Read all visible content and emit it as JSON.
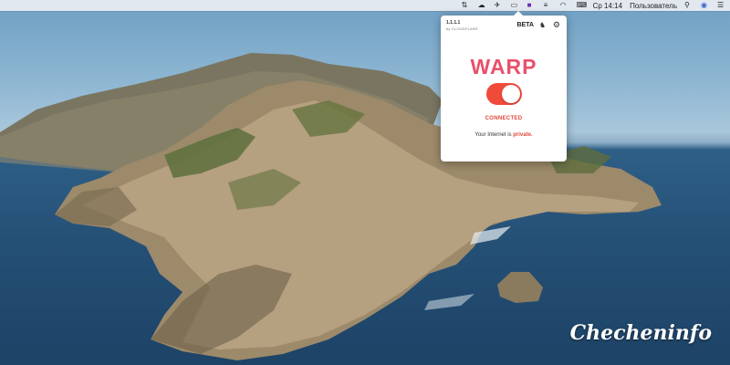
{
  "menubar": {
    "items": [
      {
        "icon": "network-icon",
        "glyph": "⇅"
      },
      {
        "icon": "cloudflare-warp-icon",
        "glyph": "☁"
      },
      {
        "icon": "telegram-icon",
        "glyph": "✈"
      },
      {
        "icon": "display-icon",
        "glyph": "▭"
      },
      {
        "icon": "app-icon",
        "glyph": "■"
      },
      {
        "icon": "menu-icon",
        "glyph": "≡"
      },
      {
        "icon": "wifi-icon",
        "glyph": "◠"
      },
      {
        "icon": "keyboard-icon",
        "glyph": "⌨"
      }
    ],
    "clock": "Ср 14:14",
    "user": "Пользователь",
    "search_glyph": "⚲",
    "siri_glyph": "◉",
    "notif_glyph": "☰"
  },
  "popup": {
    "version": "1.1.1.1",
    "by": "by CLOUDFLARE",
    "beta": "BETA",
    "bug_glyph": "♞",
    "gear_glyph": "⚙",
    "title": "WARP",
    "toggle_on": true,
    "status": "CONNECTED",
    "tagline_prefix": "Your Internet is ",
    "tagline_emph": "private."
  },
  "colors": {
    "accent": "#e9506a",
    "toggle": "#f04b3a",
    "status": "#e0473a"
  }
}
